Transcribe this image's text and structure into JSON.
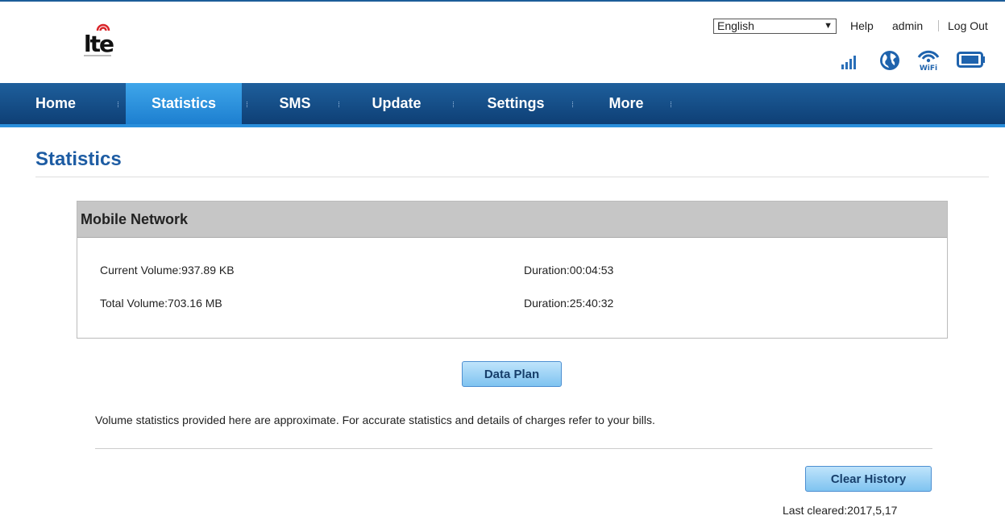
{
  "header": {
    "logo_text": "lte",
    "language": {
      "selected": "English"
    },
    "links": {
      "help": "Help",
      "user": "admin",
      "logout": "Log Out"
    },
    "status_icons": [
      "signal-icon",
      "internet-globe-icon",
      "wifi-icon",
      "battery-icon"
    ]
  },
  "nav": {
    "items": [
      {
        "label": "Home"
      },
      {
        "label": "Statistics"
      },
      {
        "label": "SMS"
      },
      {
        "label": "Update"
      },
      {
        "label": "Settings"
      },
      {
        "label": "More"
      }
    ],
    "active": "Statistics"
  },
  "page": {
    "title": "Statistics"
  },
  "mobile_network": {
    "heading": "Mobile Network",
    "current_volume": "Current Volume:937.89 KB",
    "current_duration": "Duration:00:04:53",
    "total_volume": "Total Volume:703.16 MB",
    "total_duration": "Duration:25:40:32"
  },
  "buttons": {
    "data_plan": "Data Plan",
    "clear_history": "Clear History"
  },
  "note": "Volume statistics provided here are approximate. For accurate statistics and details of charges refer to your bills.",
  "last_cleared": "Last cleared:2017,5,17",
  "colors": {
    "nav": "#1e5f9c",
    "nav_active": "#3fa6ea",
    "title": "#1d5ca3",
    "button": "#8fcaf2"
  }
}
